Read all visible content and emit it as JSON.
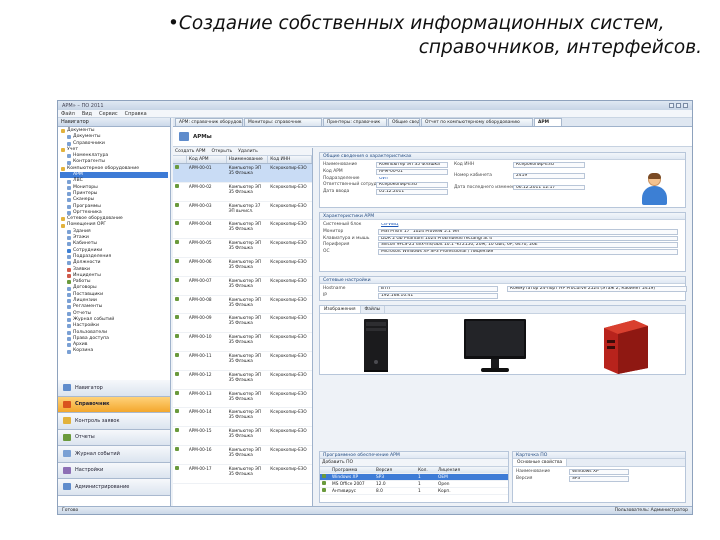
{
  "slide": {
    "bullet": "•",
    "title_line1": "Создание собственных информационных систем,",
    "title_line2": "справочников, интерфейсов."
  },
  "window": {
    "title": "АРМ» – ПО 2011"
  },
  "menu": [
    "Файл",
    "Вид",
    "Сервис",
    "Справка"
  ],
  "nav": {
    "header": "Навигатор",
    "tree": [
      {
        "label": "Документы",
        "icon": "folder-icon",
        "color": "#e2b23c"
      },
      {
        "label": "Документы",
        "icon": "doc-icon",
        "color": "#7aa0d4"
      },
      {
        "label": "Справочники",
        "icon": "doc-icon",
        "color": "#7aa0d4"
      },
      {
        "label": "Учет",
        "icon": "folder-icon",
        "color": "#e2b23c"
      },
      {
        "label": "Номенклатура",
        "icon": "doc-icon",
        "color": "#7aa0d4"
      },
      {
        "label": "Контрагенты",
        "icon": "doc-icon",
        "color": "#7aa0d4"
      },
      {
        "label": "Компьютерное оборудование",
        "icon": "folder-icon",
        "color": "#e2b23c"
      },
      {
        "label": "АРМ",
        "icon": "monitor-icon",
        "color": "#3d7bd6",
        "selected": true
      },
      {
        "label": "ЛВС",
        "icon": "doc-icon",
        "color": "#7aa0d4"
      },
      {
        "label": "Мониторы",
        "icon": "doc-icon",
        "color": "#7aa0d4"
      },
      {
        "label": "Принтеры",
        "icon": "doc-icon",
        "color": "#7aa0d4"
      },
      {
        "label": "Сканеры",
        "icon": "doc-icon",
        "color": "#7aa0d4"
      },
      {
        "label": "Программы",
        "icon": "doc-icon",
        "color": "#7aa0d4"
      },
      {
        "label": "Оргтехника",
        "icon": "doc-icon",
        "color": "#7aa0d4"
      },
      {
        "label": "Сетевое оборудование",
        "icon": "folder-icon",
        "color": "#e2b23c"
      },
      {
        "label": "Помещения ОРГ",
        "icon": "folder-icon",
        "color": "#e2b23c"
      },
      {
        "label": "Здания",
        "icon": "doc-icon",
        "color": "#7aa0d4"
      },
      {
        "label": "Этажи",
        "icon": "doc-icon",
        "color": "#7aa0d4"
      },
      {
        "label": "Кабинеты",
        "icon": "doc-icon",
        "color": "#7aa0d4"
      },
      {
        "label": "Сотрудники",
        "icon": "person-icon",
        "color": "#3c7fd4"
      },
      {
        "label": "Подразделения",
        "icon": "doc-icon",
        "color": "#7aa0d4"
      },
      {
        "label": "Должности",
        "icon": "doc-icon",
        "color": "#7aa0d4"
      },
      {
        "label": "Заявки",
        "icon": "doc-icon",
        "color": "#d05a4a"
      },
      {
        "label": "Инциденты",
        "icon": "doc-icon",
        "color": "#d05a4a"
      },
      {
        "label": "Работы",
        "icon": "doc-icon",
        "color": "#6a9a3c"
      },
      {
        "label": "Договоры",
        "icon": "doc-icon",
        "color": "#7aa0d4"
      },
      {
        "label": "Поставщики",
        "icon": "doc-icon",
        "color": "#7aa0d4"
      },
      {
        "label": "Лицензии",
        "icon": "doc-icon",
        "color": "#7aa0d4"
      },
      {
        "label": "Регламенты",
        "icon": "doc-icon",
        "color": "#7aa0d4"
      },
      {
        "label": "Отчеты",
        "icon": "doc-icon",
        "color": "#7aa0d4"
      },
      {
        "label": "Журнал событий",
        "icon": "doc-icon",
        "color": "#7aa0d4"
      },
      {
        "label": "Настройки",
        "icon": "doc-icon",
        "color": "#7aa0d4"
      },
      {
        "label": "Пользователи",
        "icon": "doc-icon",
        "color": "#7aa0d4"
      },
      {
        "label": "Права доступа",
        "icon": "doc-icon",
        "color": "#7aa0d4"
      },
      {
        "label": "Архив",
        "icon": "doc-icon",
        "color": "#7aa0d4"
      },
      {
        "label": "Корзина",
        "icon": "doc-icon",
        "color": "#7aa0d4"
      }
    ],
    "sections": [
      {
        "label": "Навигатор",
        "color": "#5f8ccc"
      },
      {
        "label": "Справочник",
        "color": "#d9531e",
        "active": true
      },
      {
        "label": "Контроль заявок",
        "color": "#e2b23c"
      },
      {
        "label": "Отчеты",
        "color": "#6a9a3c"
      },
      {
        "label": "Журнал событий",
        "color": "#7aa0d4"
      },
      {
        "label": "Настройки",
        "color": "#8d6fb5"
      },
      {
        "label": "Администрирование",
        "color": "#5f8ccc"
      }
    ]
  },
  "tabs": [
    "АРМ: справочник оборудования",
    "Мониторы: справочник",
    "Принтеры: справочник",
    "Общие сведения",
    "Отчет по компьютерному оборудованию",
    "АРМ"
  ],
  "document": {
    "title": "АРМы"
  },
  "catalog": {
    "toolbar": [
      "Создать АРМ",
      "Открыть",
      "Удалить"
    ],
    "columns": [
      "",
      "Код АРМ",
      "Наименование",
      "Код ИНН"
    ],
    "rows": [
      {
        "code": "АРМ-00-01",
        "name": "Компьютер ЭП 35 Флэшка",
        "inn": "Ксерокопир-ЕЗО",
        "sel": true
      },
      {
        "code": "АРМ-00-02",
        "name": "Компьютер ЭП 35 Флэшка",
        "inn": "Ксерокопир-ЕЗО"
      },
      {
        "code": "АРМ-00-03",
        "name": "Компьютер 37 ЭП вычисл.",
        "inn": "Ксерокопир-ЕЗО"
      },
      {
        "code": "АРМ-00-04",
        "name": "Компьютер ЭП 35 Флэшка",
        "inn": "Ксерокопир-ЕЗО"
      },
      {
        "code": "АРМ-00-05",
        "name": "Компьютер ЭП 35 Флэшка",
        "inn": "Ксерокопир-ЕЗО"
      },
      {
        "code": "АРМ-00-06",
        "name": "Компьютер ЭП 35 Флэшка",
        "inn": "Ксерокопир-ЕЗО"
      },
      {
        "code": "АРМ-00-07",
        "name": "Компьютер ЭП 35 Флэшка",
        "inn": "Ксерокопир-ЕЗО"
      },
      {
        "code": "АРМ-00-08",
        "name": "Компьютер ЭП 35 Флэшка",
        "inn": "Ксерокопир-ЕЗО"
      },
      {
        "code": "АРМ-00-09",
        "name": "Компьютер ЭП 35 Флэшка",
        "inn": "Ксерокопир-ЕЗО"
      },
      {
        "code": "АРМ-00-10",
        "name": "Компьютер ЭП 35 Флэшка",
        "inn": "Ксерокопир-ЕЗО"
      },
      {
        "code": "АРМ-00-11",
        "name": "Компьютер ЭП 35 Флэшка",
        "inn": "Ксерокопир-ЕЗО"
      },
      {
        "code": "АРМ-00-12",
        "name": "Компьютер ЭП 35 Флэшка",
        "inn": "Ксерокопир-ЕЗО"
      },
      {
        "code": "АРМ-00-13",
        "name": "Компьютер ЭП 35 Флэшка",
        "inn": "Ксерокопир-ЕЗО"
      },
      {
        "code": "АРМ-00-14",
        "name": "Компьютер ЭП 35 Флэшка",
        "inn": "Ксерокопир-ЕЗО"
      },
      {
        "code": "АРМ-00-15",
        "name": "Компьютер ЭП 35 Флэшка",
        "inn": "Ксерокопир-ЕЗО"
      },
      {
        "code": "АРМ-00-16",
        "name": "Компьютер ЭП 35 Флэшка",
        "inn": "Ксерокопир-ЕЗО"
      },
      {
        "code": "АРМ-00-17",
        "name": "Компьютер ЭП 35 Флэшка",
        "inn": "Ксерокопир-ЕЗО"
      }
    ]
  },
  "detail": {
    "general": {
      "title": "Общие сведения о характеристиках",
      "fields": [
        {
          "label": "Наименование",
          "value": "Компьютер ЭП 35 Флэшка"
        },
        {
          "label": "Код АРМ",
          "value": "АРМ-00-01"
        },
        {
          "label": "Подразделение",
          "value": "ОИТ",
          "link": true
        },
        {
          "label": "Ответственный сотрудник",
          "value": "Ксерокопир-ЕЗО"
        },
        {
          "label": "Дата ввода",
          "value": "05.12.2011"
        }
      ],
      "right_fields": [
        {
          "label": "Код ИНН",
          "value": "Ксерокопир-ЕЗО"
        },
        {
          "label": "Номер кабинета",
          "value": "2419"
        },
        {
          "label": "Дата последнего изменения",
          "value": "06.12.2011 12:17"
        }
      ]
    },
    "config": {
      "title": "Характеристики АРМ",
      "fields": [
        {
          "label": "Системный блок",
          "value": "СБ-ИВЦ",
          "link": true
        },
        {
          "label": "Монитор",
          "value": "MSI Prism 17\" 1024 Proview 5.1 Ver"
        },
        {
          "label": "Клавиатура и мышь",
          "value": "DDR 2 Gb Phantom 1024 ProEmbedd rectangl at 4"
        },
        {
          "label": "Периферия",
          "value": "Silicon 9FLS-25 dvx-ms/Gbit 10.1 -KT2150, 20M, 10 Gbit, 6P, 6470, 26E"
        },
        {
          "label": "ОС",
          "value": "Microsoft Windows XP SP3 Professional / Лицензия"
        }
      ]
    },
    "network": {
      "title": "Сетевые настройки",
      "fields": [
        {
          "label": "Hostname",
          "value": "ВТП"
        },
        {
          "label": "IP",
          "value": "192.168.10.41"
        }
      ],
      "right_fields": [
        {
          "label": "",
          "value": "Коммутатор 24-порт HP ProCurve 2524 (Этаж 2, Кабинет 2419)"
        }
      ]
    },
    "gallery": {
      "tabs": [
        "Изображения",
        "Файлы"
      ],
      "items": [
        "system-unit-image",
        "monitor-image",
        "red-device-image"
      ]
    },
    "bottom_grid": {
      "title": "Программное обеспечение АРМ",
      "toolbar": "Добавить ПО",
      "columns": [
        "",
        "Программа",
        "Версия",
        "Кол.",
        "Лицензия"
      ],
      "rows": [
        {
          "a": "Windows XP",
          "b": "SP3",
          "c": "1",
          "d": "OEM",
          "sel": true
        },
        {
          "a": "MS Office 2007",
          "b": "12.0",
          "c": "1",
          "d": "Open"
        },
        {
          "a": "Антивирус",
          "b": "8.0",
          "c": "1",
          "d": "Корп."
        }
      ]
    },
    "bottom_card": {
      "title": "Карточка ПО",
      "tab": "Основные свойства",
      "fields": [
        {
          "label": "Наименование",
          "value": "Windows XP"
        },
        {
          "label": "Версия",
          "value": "SP3"
        }
      ]
    }
  },
  "status": {
    "left": "Готово",
    "right": "Пользователь: Администратор"
  }
}
